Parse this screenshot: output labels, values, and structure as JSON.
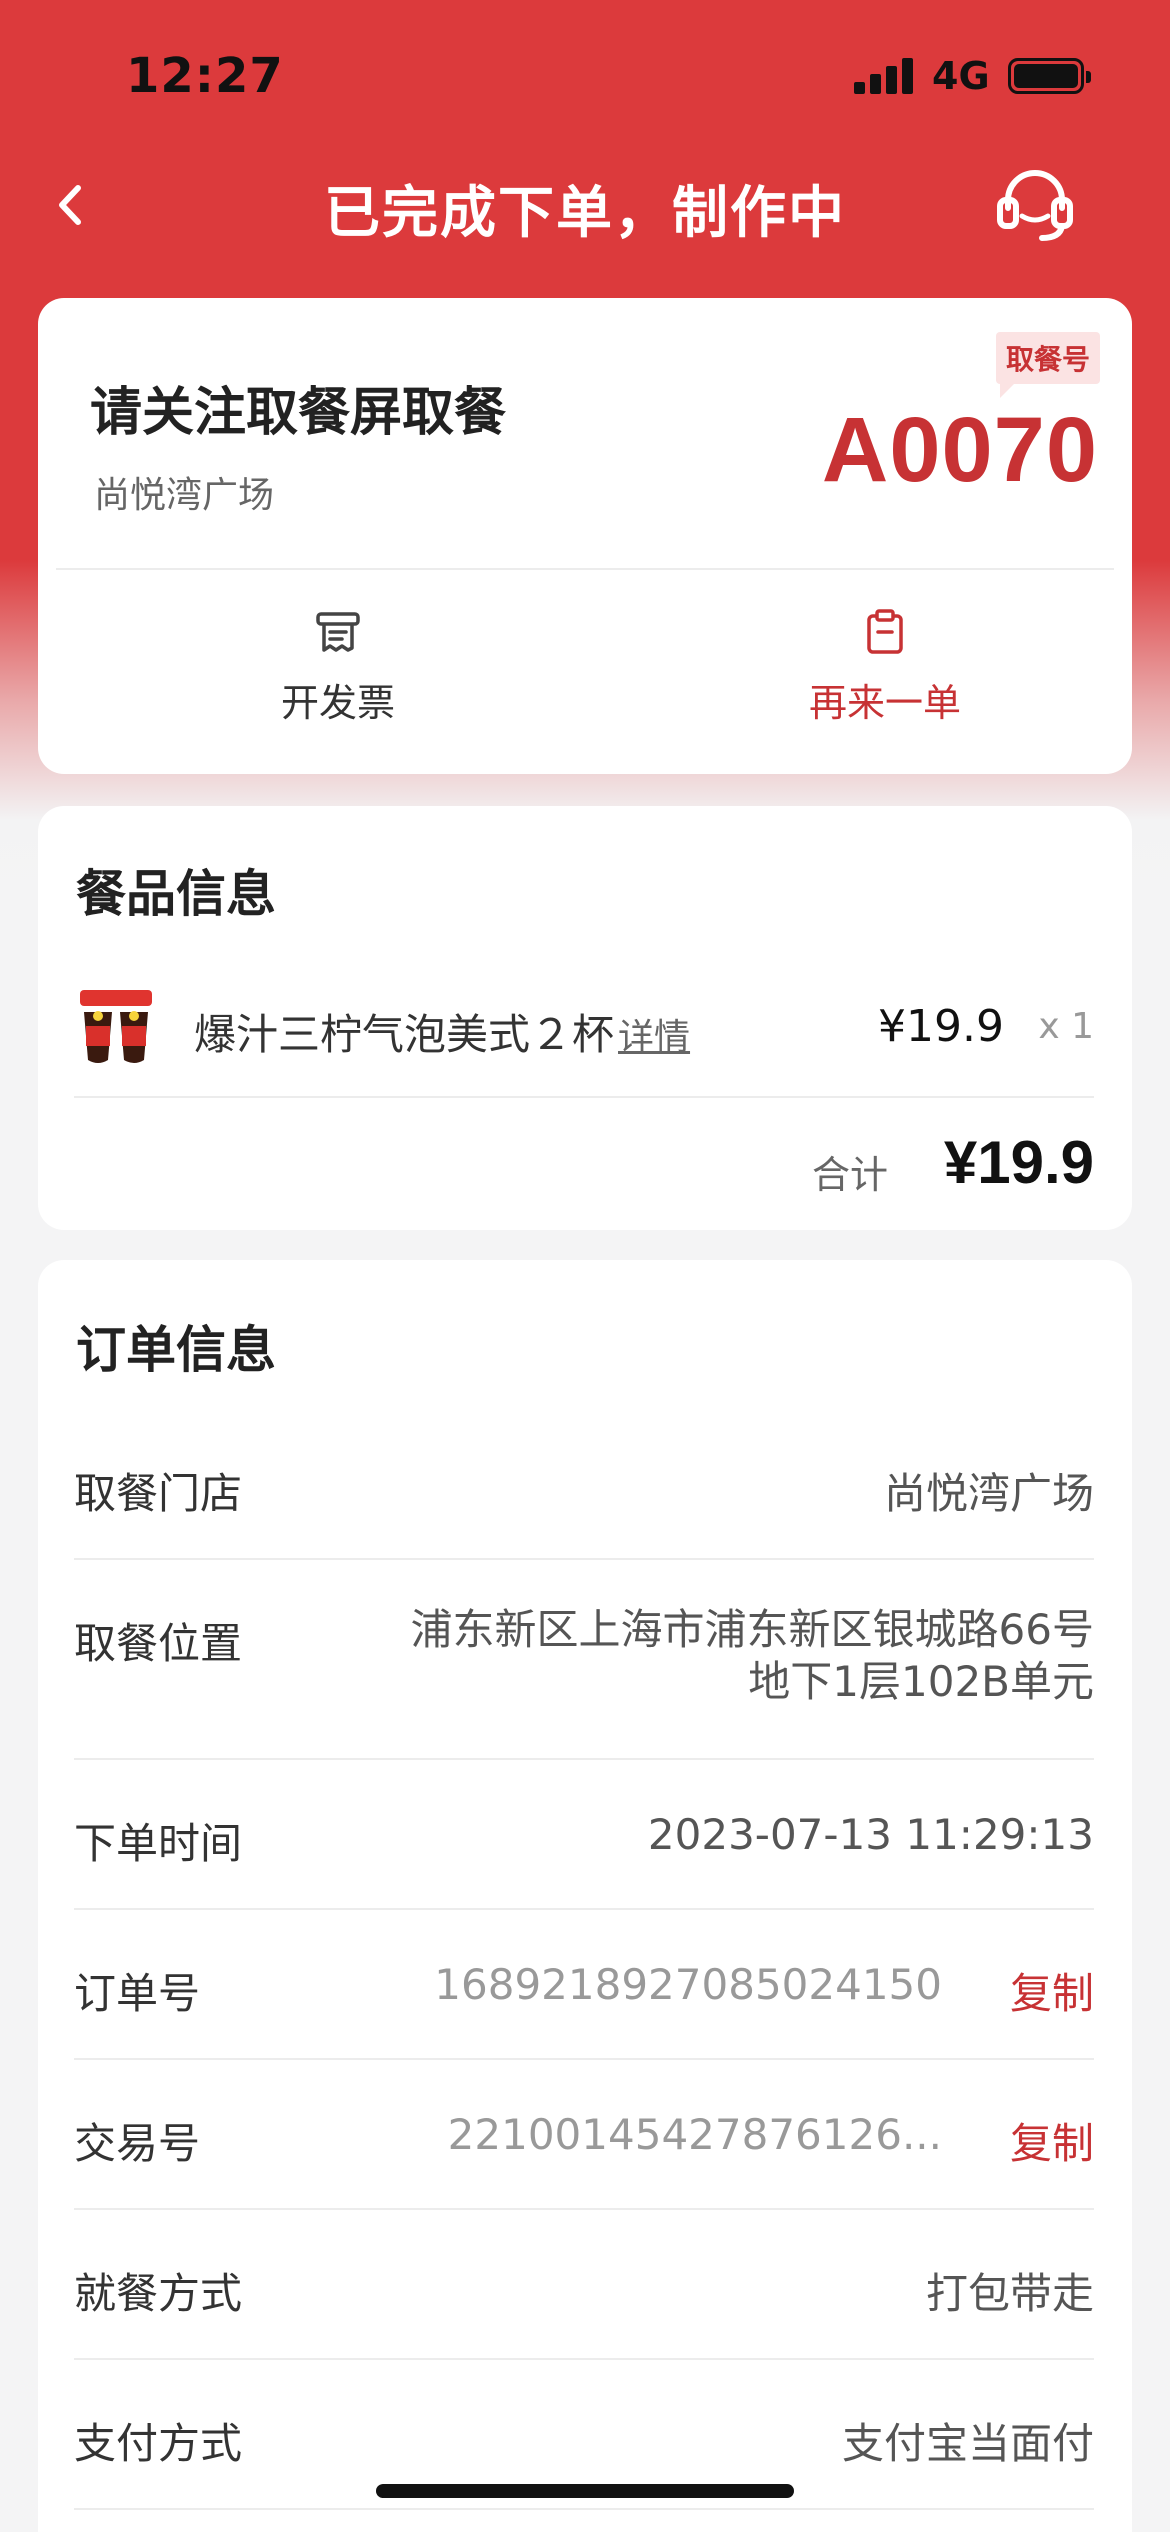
{
  "status_bar": {
    "time": "12:27",
    "network": "4G"
  },
  "nav": {
    "title": "已完成下单，制作中",
    "back_icon": "chevron-left-icon",
    "support_icon": "headset-icon"
  },
  "pickup": {
    "heading": "请关注取餐屏取餐",
    "store": "尚悦湾广场",
    "badge": "取餐号",
    "code": "A0070",
    "actions": [
      {
        "label": "开发票",
        "icon": "receipt-icon"
      },
      {
        "label": "再来一单",
        "icon": "clipboard-icon"
      }
    ]
  },
  "food": {
    "title": "餐品信息",
    "items": [
      {
        "name": "爆汁三柠气泡美式２杯",
        "detail_label": "详情",
        "price": "¥19.9",
        "qty": "x 1"
      }
    ],
    "total_label": "合计",
    "total_value": "¥19.9"
  },
  "order": {
    "title": "订单信息",
    "rows": [
      {
        "label": "取餐门店",
        "value": "尚悦湾广场"
      },
      {
        "label": "取餐位置",
        "value": "浦东新区上海市浦东新区银城路66号地下1层102B单元"
      },
      {
        "label": "下单时间",
        "value": "2023-07-13 11:29:13"
      },
      {
        "label": "订单号",
        "value": "1689218927085024150",
        "action": "复制"
      },
      {
        "label": "交易号",
        "value": "22100145427876126...",
        "action": "复制"
      },
      {
        "label": "就餐方式",
        "value": "打包带走"
      },
      {
        "label": "支付方式",
        "value": "支付宝当面付"
      }
    ]
  },
  "colors": {
    "brand_red": "#dc3a3c",
    "accent_red": "#c73234"
  }
}
